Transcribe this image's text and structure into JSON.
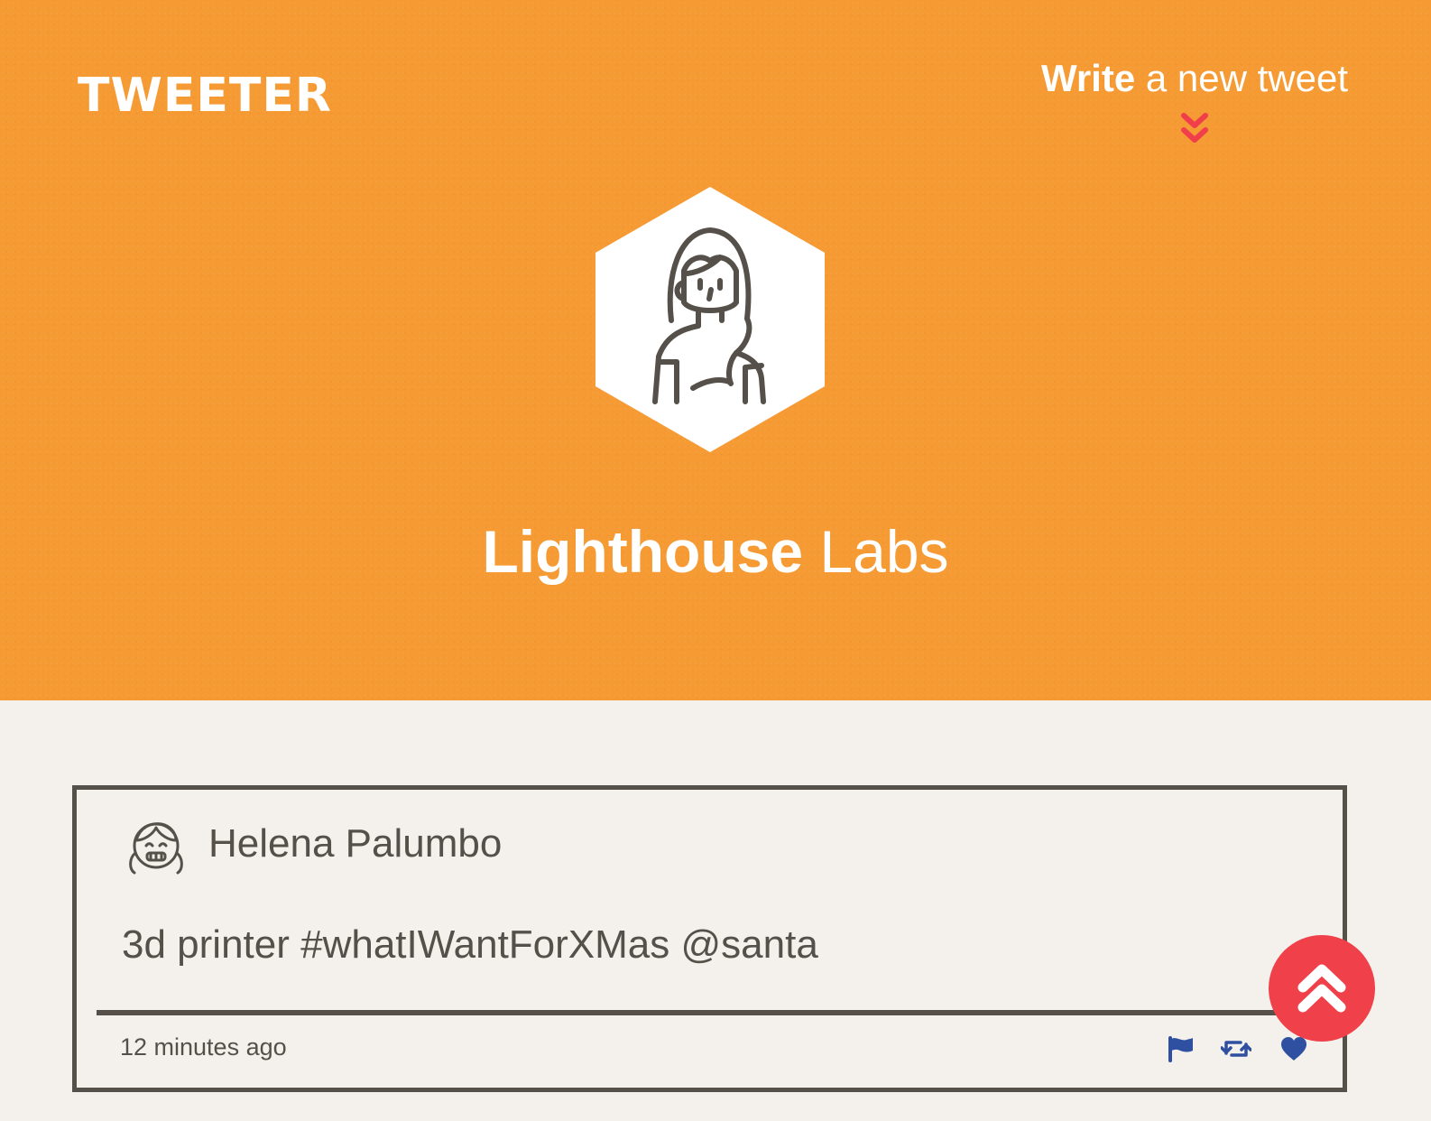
{
  "nav": {
    "brand": "TWEETER",
    "compose_strong": "Write",
    "compose_light": " a new tweet",
    "compose_arrow_icon": "double-chevron-down-icon",
    "accent_color": "#f03e4a"
  },
  "profile": {
    "avatar_icon": "woman-avatar-icon",
    "name_strong": "Lighthouse",
    "name_light": " Labs",
    "background_color": "#f69a34"
  },
  "tweets": [
    {
      "avatar_icon": "girl-avatar-icon",
      "author": "Helena Palumbo",
      "text": "3d printer #whatIWantForXMas @santa",
      "time": "12 minutes ago",
      "actions": [
        {
          "name": "flag",
          "icon": "flag-icon"
        },
        {
          "name": "retweet",
          "icon": "retweet-icon"
        },
        {
          "name": "like",
          "icon": "heart-icon"
        }
      ]
    }
  ],
  "scroll_top": {
    "icon": "double-chevron-up-icon",
    "color": "#f0404a"
  }
}
